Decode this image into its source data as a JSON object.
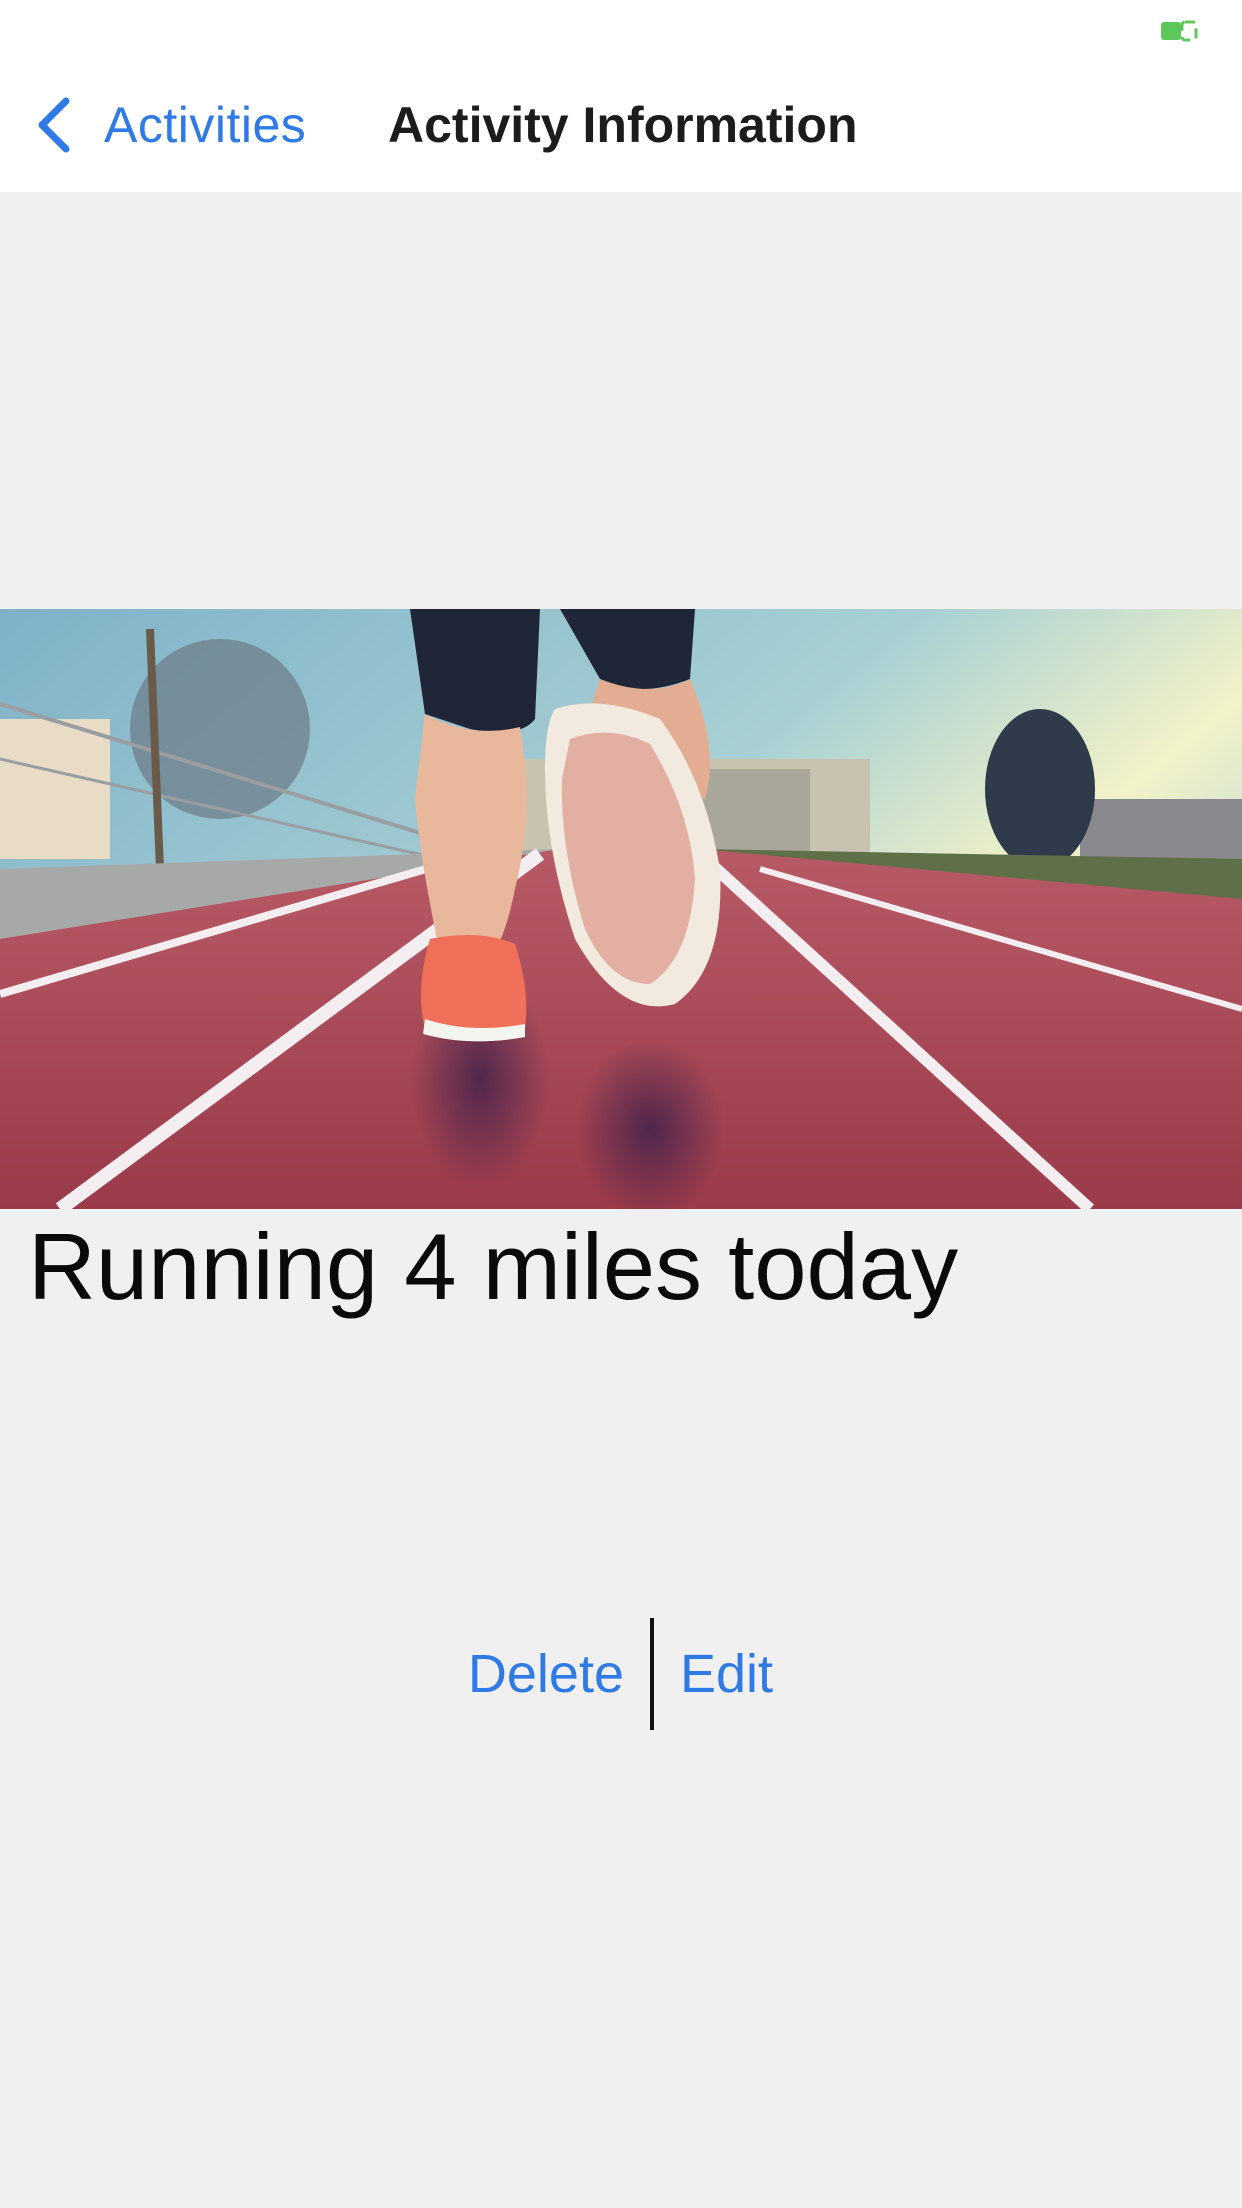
{
  "nav": {
    "back_label": "Activities",
    "title": "Activity Information"
  },
  "status_bar": {
    "battery_icon": "battery-charging-icon",
    "battery_color": "#5cc85c"
  },
  "activity": {
    "image_description_icon": "running-track-photo",
    "title": "Running 4 miles today"
  },
  "actions": {
    "delete_label": "Delete",
    "edit_label": "Edit"
  },
  "colors": {
    "accent": "#2f7ae5",
    "background": "#f0f0f0"
  }
}
